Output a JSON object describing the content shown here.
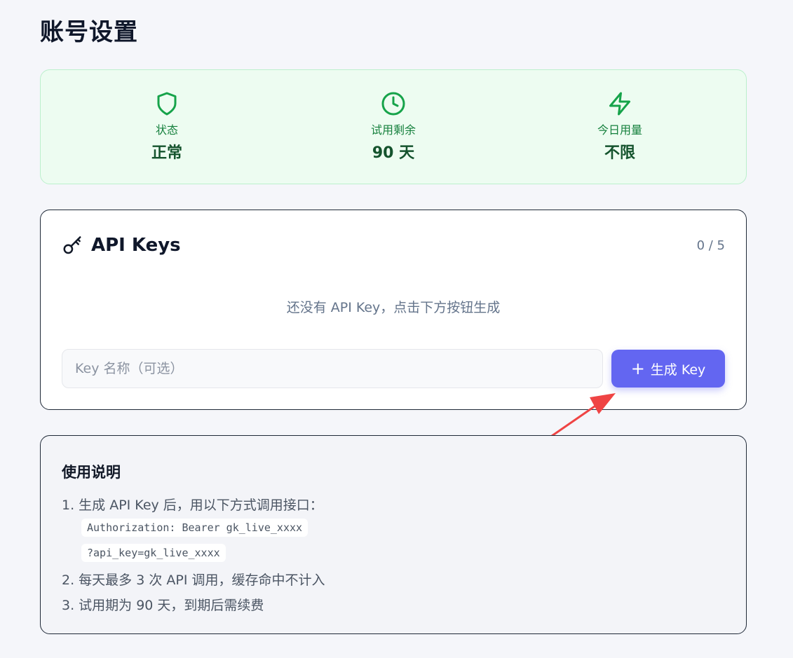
{
  "page": {
    "title": "账号设置"
  },
  "status": {
    "items": [
      {
        "icon": "shield-icon",
        "label": "状态",
        "value": "正常"
      },
      {
        "icon": "clock-icon",
        "label": "试用剩余",
        "value": "90 天"
      },
      {
        "icon": "lightning-icon",
        "label": "今日用量",
        "value": "不限"
      }
    ],
    "accent": "#16a34a"
  },
  "api_keys": {
    "title": "API Keys",
    "count": "0 / 5",
    "empty_text": "还没有 API Key，点击下方按钮生成",
    "input_placeholder": "Key 名称（可选）",
    "generate_label": "生成 Key",
    "button_color": "#6366f1"
  },
  "usage": {
    "title": "使用说明",
    "lines": [
      "1. 生成 API Key 后，用以下方式调用接口：",
      "2. 每天最多 3 次 API 调用，缓存命中不计入",
      "3. 试用期为 90 天，到期后需续费"
    ],
    "code": [
      "Authorization: Bearer gk_live_xxxx",
      "?api_key=gk_live_xxxx"
    ]
  }
}
